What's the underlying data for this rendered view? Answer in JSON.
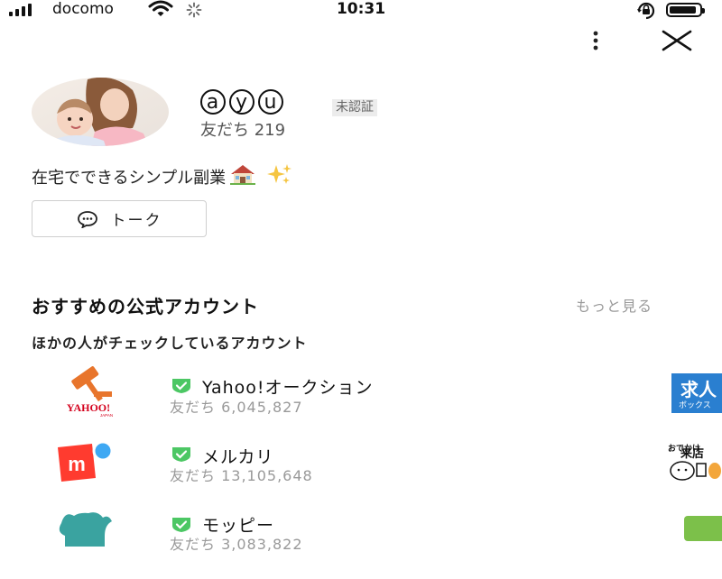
{
  "status_bar": {
    "carrier": "docomo",
    "time": "10:31",
    "signal_icon": "signal-bars-icon",
    "wifi_icon": "wifi-icon",
    "battery_level": 0.9
  },
  "header": {
    "more_icon": "more-vertical-icon",
    "close_icon": "close-icon"
  },
  "profile": {
    "name_letters": [
      "a",
      "y",
      "u"
    ],
    "unverified_badge": "未認証",
    "friends_label": "友だち 219",
    "status_message": "在宅でできるシンプル副業",
    "talk_button": "トーク"
  },
  "recommended": {
    "title": "おすすめの公式アカウント",
    "see_more": "もっと見る",
    "subtitle": "ほかの人がチェックしているアカウント",
    "accounts": [
      {
        "name": "Yahoo!オークション",
        "friends": "友だち 6,045,827"
      },
      {
        "name": "メルカリ",
        "friends": "友だち 13,105,648"
      },
      {
        "name": "モッピー",
        "friends": "友だち 3,083,822"
      }
    ],
    "side_cards": [
      {
        "label": "求人",
        "sub": "ボックス"
      },
      {
        "label": "来店",
        "sub": "おでかけ"
      }
    ]
  },
  "colors": {
    "verified_green": "#4cc764",
    "yahoo_orange": "#e8752c",
    "mercari_red": "#ff3b2f",
    "moppy_teal": "#3aa3a0"
  }
}
